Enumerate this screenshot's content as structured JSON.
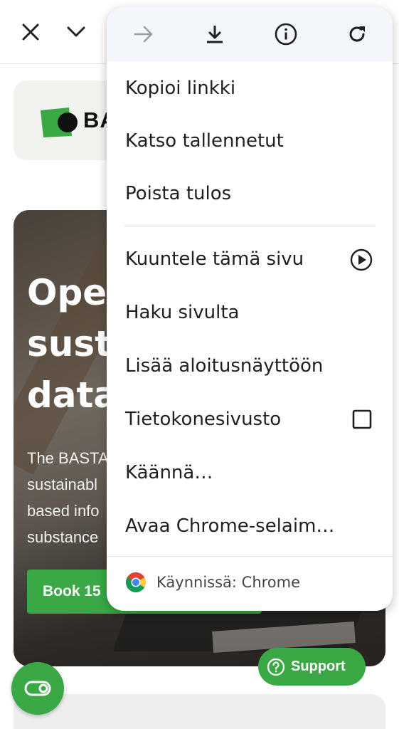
{
  "topbar": {
    "close_icon": "close-icon",
    "expand_icon": "chevron-down-icon"
  },
  "page": {
    "logo_text": "BA",
    "hero_title": "Oper\nsust\ndata",
    "hero_body": "The BASTA\nsustainabl\nbased info\nsubstance",
    "hero_button": "Book 15",
    "support_label": "Support",
    "accent_color": "#3aa845"
  },
  "menu": {
    "actions": [
      "forward-arrow-icon",
      "download-icon",
      "info-icon",
      "refresh-icon"
    ],
    "items": [
      {
        "label": "Kopioi linkki"
      },
      {
        "label": "Katso tallennetut"
      },
      {
        "label": "Poista tulos"
      },
      {
        "label": "Kuuntele tämä sivu",
        "trailing": "play-circle-icon"
      },
      {
        "label": "Haku sivulta"
      },
      {
        "label": "Lisää aloitusnäyttöön"
      },
      {
        "label": "Tietokonesivusto",
        "trailing": "checkbox-unchecked"
      },
      {
        "label": "Käännä…"
      },
      {
        "label": "Avaa Chrome-selaim…"
      }
    ],
    "footer": {
      "label": "Käynnissä: Chrome",
      "icon": "chrome-logo-icon"
    }
  }
}
